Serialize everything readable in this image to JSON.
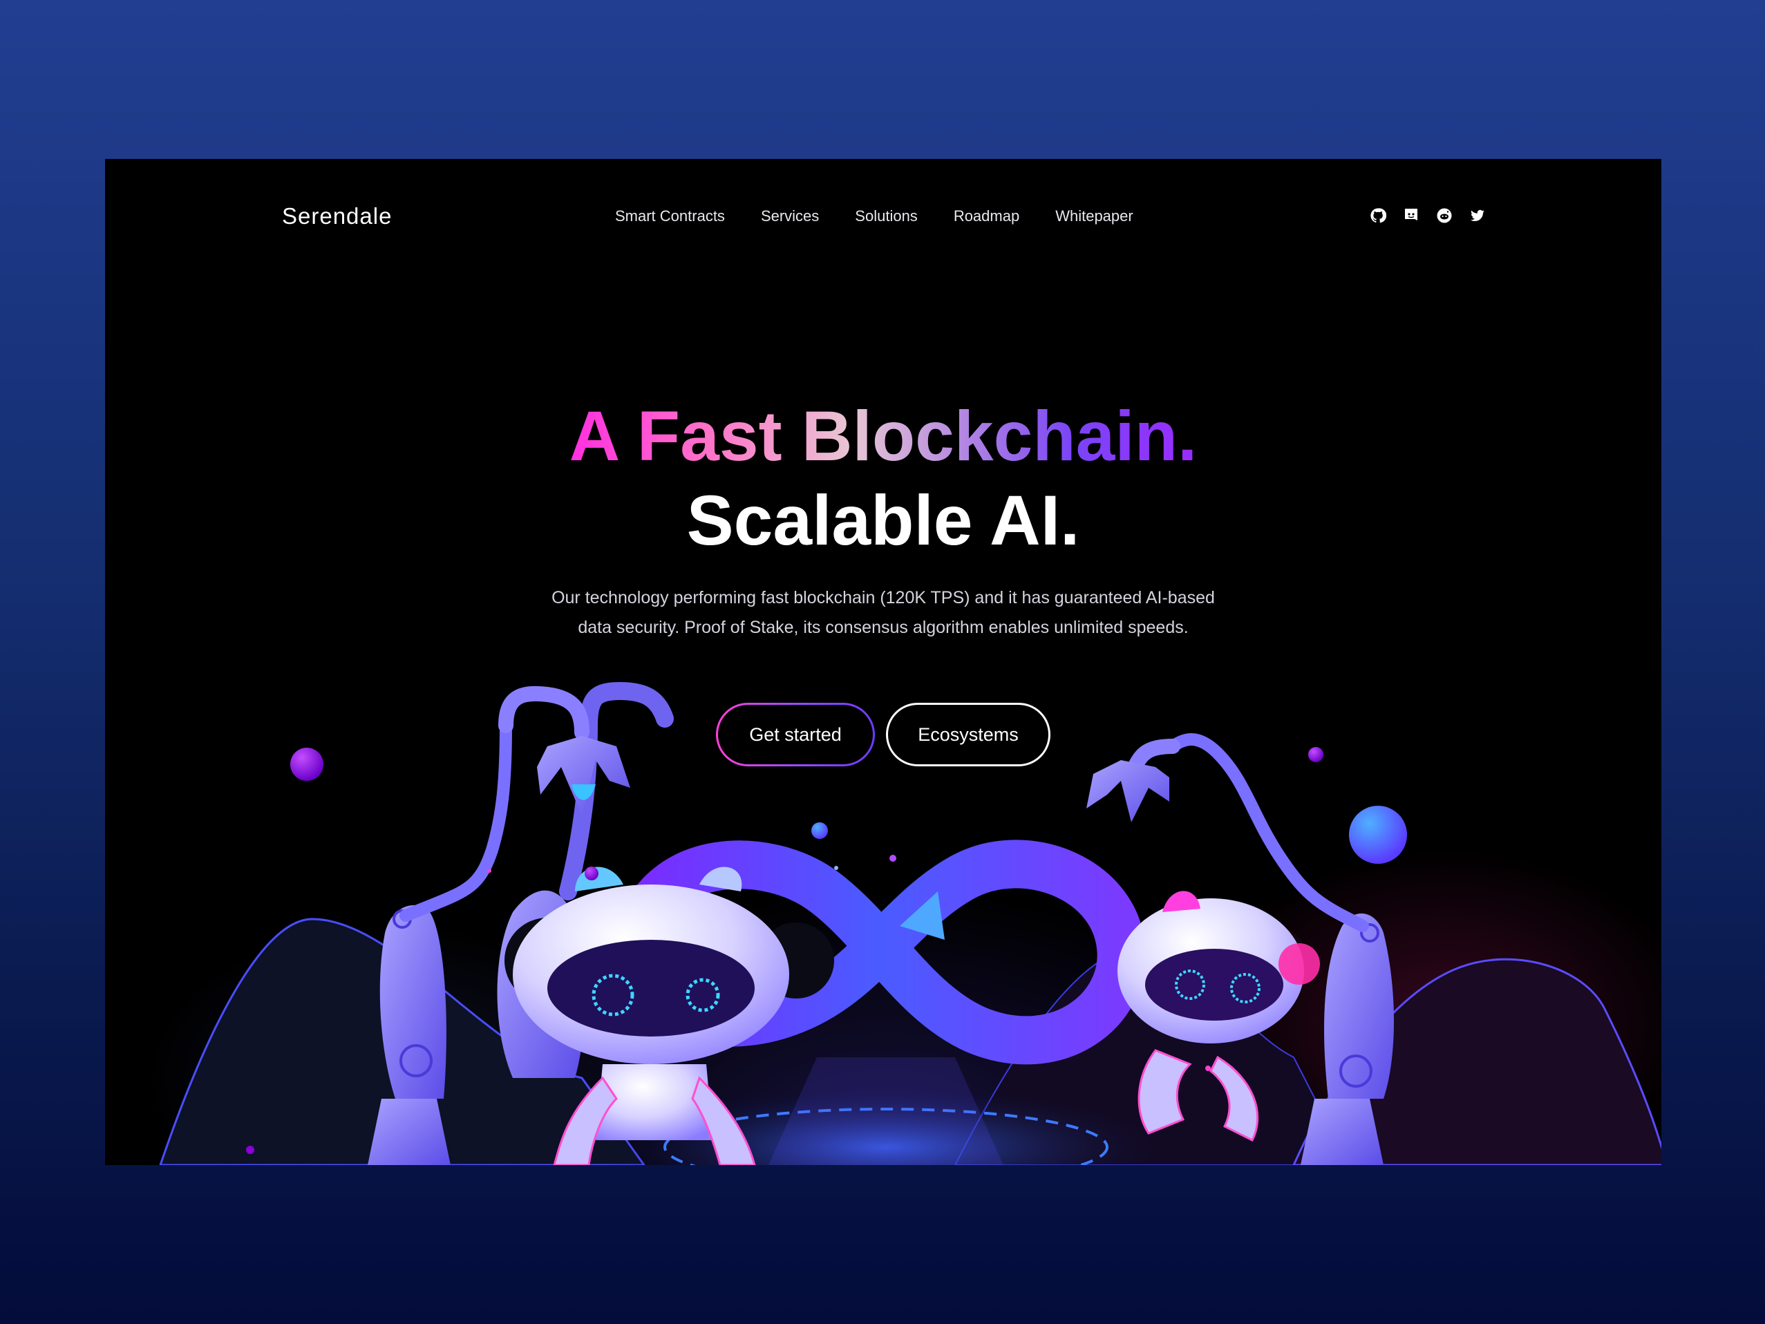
{
  "brand": {
    "name": "Serendale"
  },
  "nav": {
    "items": [
      {
        "label": "Smart Contracts"
      },
      {
        "label": "Services"
      },
      {
        "label": "Solutions"
      },
      {
        "label": "Roadmap"
      },
      {
        "label": "Whitepaper"
      }
    ]
  },
  "socials": [
    {
      "icon": "github-icon"
    },
    {
      "icon": "discord-icon"
    },
    {
      "icon": "reddit-icon"
    },
    {
      "icon": "twitter-icon"
    }
  ],
  "hero": {
    "title_gradient": "A Fast Blockchain.",
    "title_plain": "Scalable AI.",
    "description": "Our technology performing fast blockchain (120K TPS) and it has guaranteed AI-based data security. Proof of Stake, its consensus algorithm enables unlimited speeds.",
    "primary_button": "Get started",
    "secondary_button": "Ecosystems"
  },
  "colors": {
    "background_top": "#213e91",
    "background_bottom": "#030c3a",
    "frame": "#000000",
    "gradient_pink": "#ff2fe0",
    "gradient_violet": "#9a2cff",
    "robot_lilac": "#8f88ff",
    "infinity_blue": "#5b3cff"
  }
}
